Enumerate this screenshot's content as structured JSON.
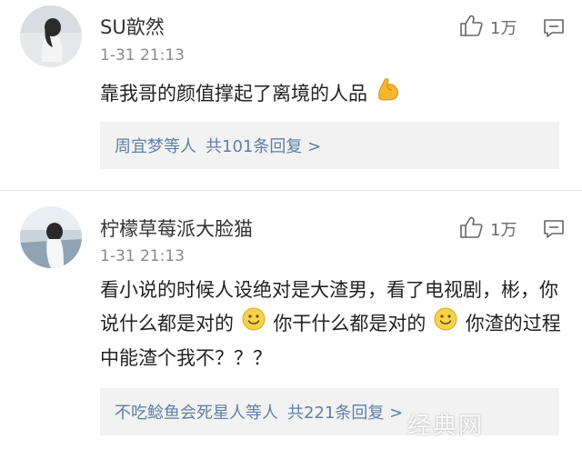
{
  "comments": [
    {
      "username": "SU歆然",
      "timestamp": "1-31 21:13",
      "likes": "1万",
      "text": "靠我哥的颜值撑起了离境的人品",
      "replies_by": "周宜梦等人",
      "replies_count": "共101条回复 >"
    },
    {
      "username": "柠檬草莓派大脸猫",
      "timestamp": "1-31 21:13",
      "likes": "1万",
      "text_part1": "看小说的时候人设绝对是大渣男，看了电视剧，彬，你说什么都是对的",
      "text_part2": "你干什么都是对的",
      "text_part3": "你渣的过程中能渣个我不？？？",
      "replies_by": "不吃鲶鱼会死星人等人",
      "replies_count": "共221条回复 >"
    }
  ],
  "watermark": "经典网",
  "icons": [
    "thumbs-up-icon",
    "reply-bubble-icon",
    "flexed-biceps-emoji",
    "smiley-emoji"
  ]
}
